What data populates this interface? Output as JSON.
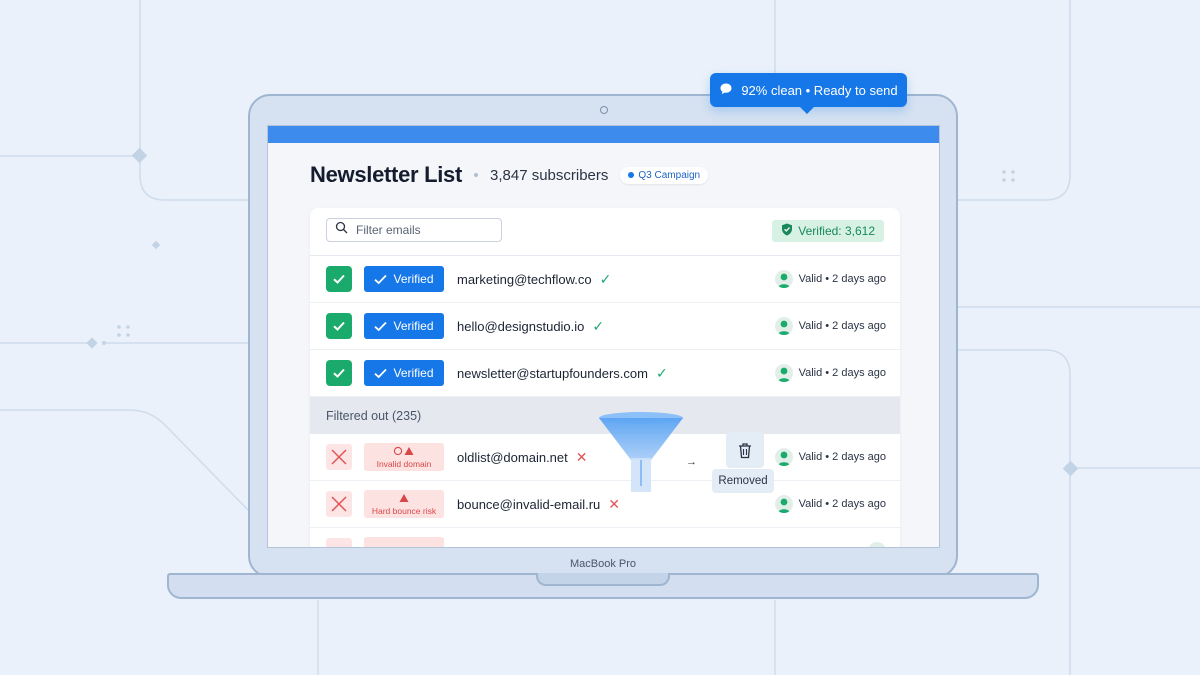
{
  "bubble": {
    "text": "92% clean • Ready to send",
    "icon": "chat-icon"
  },
  "header": {
    "title": "Newsletter List",
    "subscribers": "3,847 subscribers",
    "campaign": "Q3 Campaign"
  },
  "toolbar": {
    "search_placeholder": "Filter emails",
    "verified_count": "Verified: 3,612"
  },
  "verified_rows": [
    {
      "status": "Verified",
      "email": "marketing@techflow.co",
      "validity": "Valid • 2 days ago"
    },
    {
      "status": "Verified",
      "email": "hello@designstudio.io",
      "validity": "Valid • 2 days ago"
    },
    {
      "status": "Verified",
      "email": "newsletter@startupfounders.com",
      "validity": "Valid • 2 days ago"
    }
  ],
  "filtered_section": {
    "label": "Filtered out (235)"
  },
  "filtered_rows": [
    {
      "status": "Invalid domain",
      "email": "oldlist@domain.net",
      "validity": "Valid • 2 days ago"
    },
    {
      "status": "Hard bounce risk",
      "email": "bounce@invalid-email.ru",
      "validity": "Valid • 2 days ago"
    }
  ],
  "overlay": {
    "removed_label": "Removed",
    "arrow": "→"
  },
  "device": {
    "label": "MacBook Pro"
  },
  "colors": {
    "accent": "#1677e8",
    "success": "#1aab6c",
    "danger": "#e05555",
    "topbar": "#3d8bec"
  }
}
